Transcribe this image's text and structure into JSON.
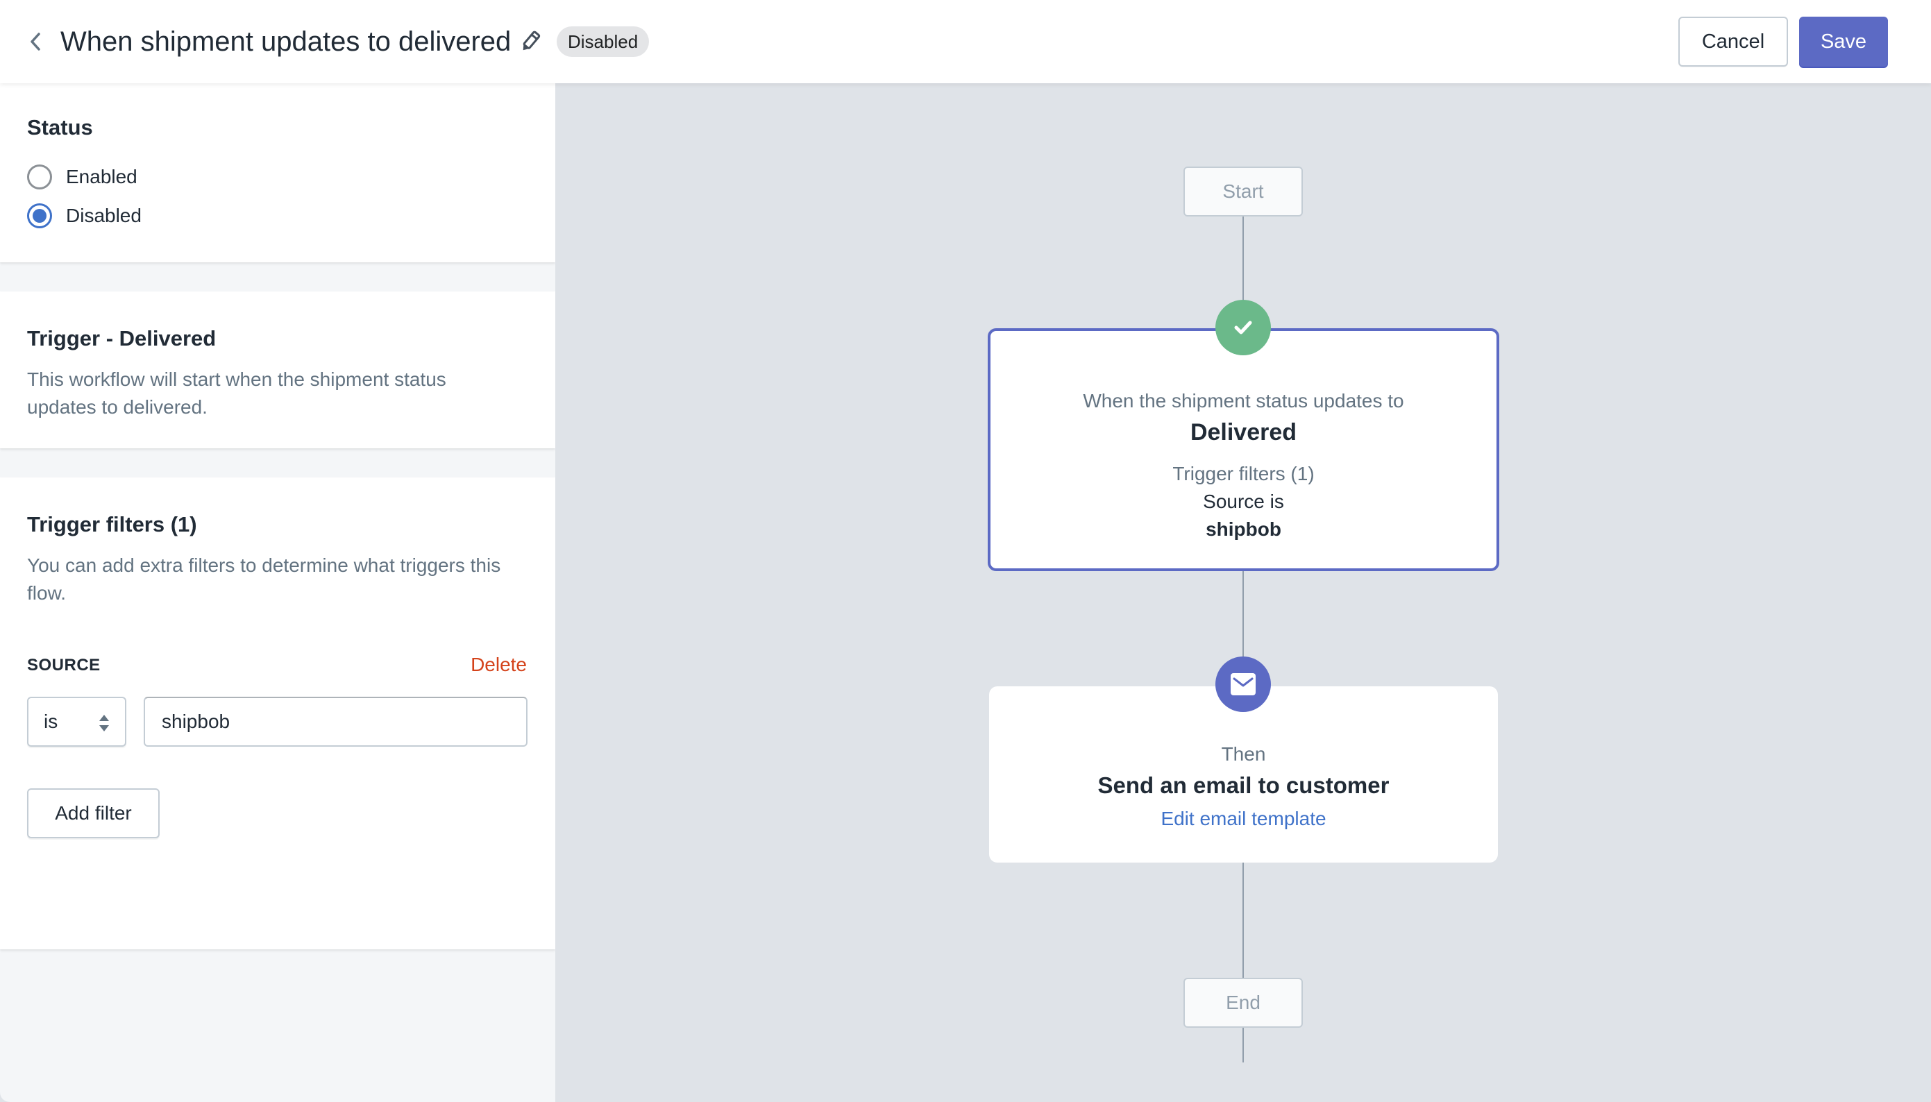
{
  "header": {
    "title": "When shipment updates to delivered",
    "status_badge": "Disabled",
    "cancel_label": "Cancel",
    "save_label": "Save",
    "icons": {
      "back": "chevron-left-icon",
      "edit": "pencil-icon"
    }
  },
  "sidebar": {
    "status": {
      "title": "Status",
      "options": [
        {
          "label": "Enabled",
          "checked": false
        },
        {
          "label": "Disabled",
          "checked": true
        }
      ]
    },
    "trigger": {
      "title": "Trigger - Delivered",
      "description": "This workflow will start when the shipment status updates to delivered."
    },
    "filters": {
      "title": "Trigger filters (1)",
      "description": "You can add extra filters to determine what triggers this flow.",
      "items": [
        {
          "field_label": "SOURCE",
          "delete_label": "Delete",
          "operator": "is",
          "value": "shipbob"
        }
      ],
      "add_filter_label": "Add filter"
    }
  },
  "canvas": {
    "start_label": "Start",
    "end_label": "End",
    "trigger_node": {
      "icon": "checkmark-icon",
      "intro": "When the shipment status updates to",
      "status": "Delivered",
      "filters_label": "Trigger filters (1)",
      "filter_text": "Source is",
      "filter_value": "shipbob"
    },
    "action_node": {
      "icon": "email-icon",
      "intro": "Then",
      "title": "Send an email to customer",
      "link_label": "Edit email template"
    }
  },
  "colors": {
    "primary": "#5c6ac4",
    "success": "#6bb98a",
    "link": "#3f72c9",
    "destructive": "#d4421a",
    "canvas_bg": "#dfe3e8"
  }
}
